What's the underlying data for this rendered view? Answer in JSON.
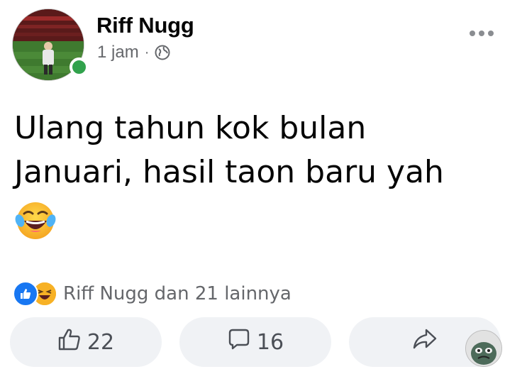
{
  "post": {
    "author": "Riff Nugg",
    "time": "1 jam",
    "separator": "·",
    "audience_icon": "globe-icon",
    "text_line1": "Ulang tahun kok bulan",
    "text_line2": "Januari, hasil taon baru yah",
    "emoji": "laughing-crying-emoji"
  },
  "reactions": {
    "types": [
      "like",
      "haha"
    ],
    "summary": "Riff Nugg dan 21 lainnya"
  },
  "actions": {
    "like_count": "22",
    "comment_count": "16",
    "share_icon": "share-icon"
  },
  "colors": {
    "online": "#31a24c",
    "like_blue": "#1877f2",
    "haha_yellow": "#f7b125",
    "secondary_text": "#65676b",
    "button_bg": "#f0f2f5"
  }
}
